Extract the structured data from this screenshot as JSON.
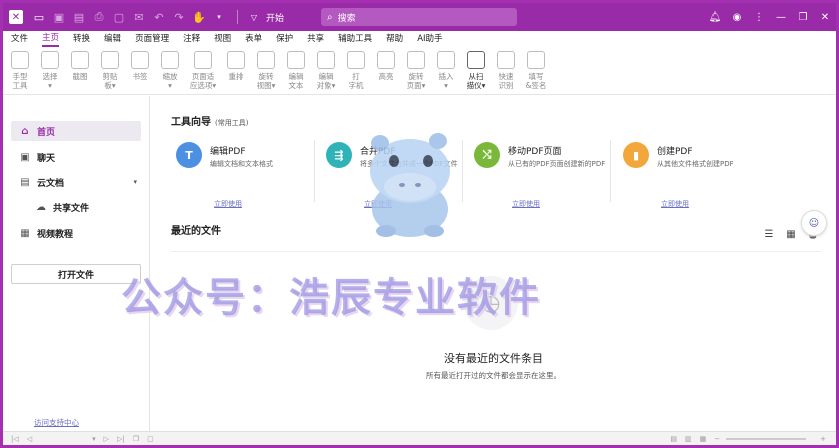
{
  "titlebar": {
    "logo": "✕",
    "start_label": "开始",
    "search_placeholder": "搜索"
  },
  "menu": [
    "文件",
    "主页",
    "转换",
    "编辑",
    "页面管理",
    "注释",
    "视图",
    "表单",
    "保护",
    "共享",
    "辅助工具",
    "帮助",
    "AI助手"
  ],
  "ribbon": [
    {
      "l1": "手型",
      "l2": "工具",
      "dark": false
    },
    {
      "l1": "选择",
      "l2": "▾",
      "dark": false
    },
    {
      "l1": "截图",
      "l2": "",
      "dark": false
    },
    {
      "l1": "剪贴",
      "l2": "板▾",
      "dark": false
    },
    {
      "l1": "书签",
      "l2": "",
      "dark": false
    },
    {
      "l1": "缩放",
      "l2": "▾",
      "dark": false
    },
    {
      "l1": "页面适",
      "l2": "应选项▾",
      "dark": false
    },
    {
      "l1": "重排",
      "l2": "",
      "dark": false
    },
    {
      "l1": "旋转",
      "l2": "视图▾",
      "dark": false
    },
    {
      "l1": "编辑",
      "l2": "文本",
      "dark": false
    },
    {
      "l1": "编辑",
      "l2": "对象▾",
      "dark": false
    },
    {
      "l1": "打",
      "l2": "字机",
      "dark": false
    },
    {
      "l1": "高亮",
      "l2": "",
      "dark": false
    },
    {
      "l1": "旋转",
      "l2": "页面▾",
      "dark": false
    },
    {
      "l1": "插入",
      "l2": "▾",
      "dark": false
    },
    {
      "l1": "从扫",
      "l2": "描仪▾",
      "dark": true
    },
    {
      "l1": "快速",
      "l2": "识别",
      "dark": false
    },
    {
      "l1": "填写",
      "l2": "&签名",
      "dark": false
    }
  ],
  "sidebar": {
    "items": [
      {
        "label": "首页",
        "icon": "home-icon"
      },
      {
        "label": "聊天",
        "icon": "chat-icon"
      },
      {
        "label": "云文档",
        "icon": "cloud-doc-icon"
      },
      {
        "label": "共享文件",
        "icon": "cloud-icon"
      },
      {
        "label": "视频教程",
        "icon": "video-icon"
      }
    ],
    "open_file": "打开文件",
    "support": "访问支持中心"
  },
  "guide": {
    "title": "工具向导",
    "subtitle": "(常用工具)",
    "cards": [
      {
        "title": "编辑PDF",
        "desc": "编辑文档和文本格式",
        "link": "立即使用",
        "color": "#4d8fe0"
      },
      {
        "title": "合并PDF",
        "desc": "将多个文件合并成一个PDF文件",
        "link": "立即使用",
        "color": "#2fb3b7"
      },
      {
        "title": "移动PDF页面",
        "desc": "从已有的PDF页面创建新的PDF",
        "link": "立即使用",
        "color": "#7ab83a"
      },
      {
        "title": "创建PDF",
        "desc": "从其他文件格式创建PDF",
        "link": "立即使用",
        "color": "#f2a73c"
      }
    ]
  },
  "recent": {
    "title": "最近的文件",
    "empty_title": "没有最近的文件条目",
    "empty_desc": "所有最近打开过的文件都会显示在这里。"
  },
  "watermark": "公众号：浩辰专业软件"
}
